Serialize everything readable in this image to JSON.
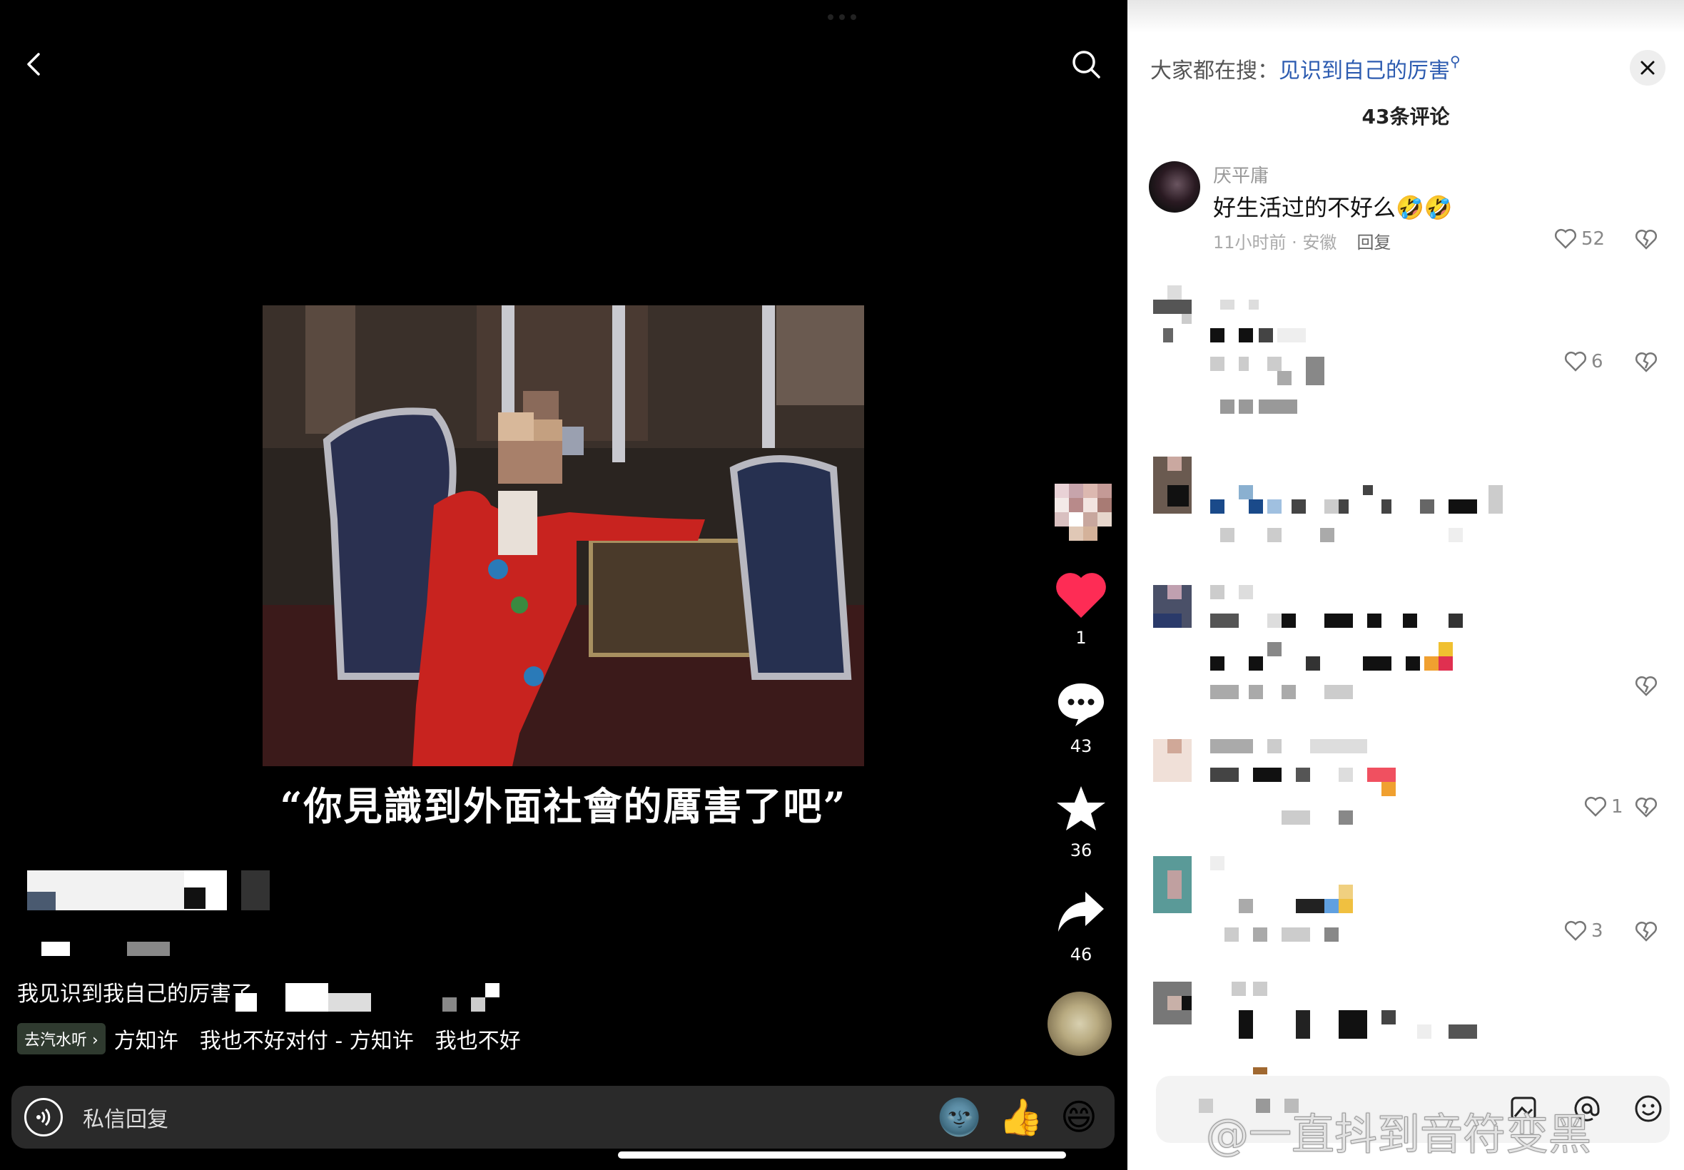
{
  "search_hint": {
    "prefix": "大家都在搜：",
    "keyword": "见识到自己的厉害"
  },
  "comments_title": "43条评论",
  "video": {
    "caption": "“你見識到外面社會的厲害了吧”"
  },
  "actions": {
    "likes": "1",
    "comments": "43",
    "favorites": "36",
    "shares": "46"
  },
  "description": "我见识到我自己的厉害了",
  "music": {
    "pill": "去汽水听 ›",
    "text": "方知许　我也不好对付 - 方知许　我也不好"
  },
  "reply_bar": {
    "placeholder": "私信回复",
    "emoji": [
      "🌚",
      "👍",
      "😄"
    ]
  },
  "comments": [
    {
      "name": "厌平庸",
      "text": "好生活过的不好么🤣🤣",
      "time": "11小时前 · 安徽",
      "reply": "回复",
      "likes": "52"
    },
    {
      "likes": "6"
    },
    {
      "likes": ""
    },
    {
      "likes": ""
    },
    {
      "likes": "1"
    },
    {
      "likes": "3"
    }
  ],
  "watermark": "@一直抖到音符变黑",
  "icons": [
    "back-icon",
    "search-icon",
    "heart-icon",
    "comment-icon",
    "star-icon",
    "share-icon",
    "close-icon",
    "voice-icon",
    "image-icon",
    "at-icon",
    "emoji-icon"
  ]
}
